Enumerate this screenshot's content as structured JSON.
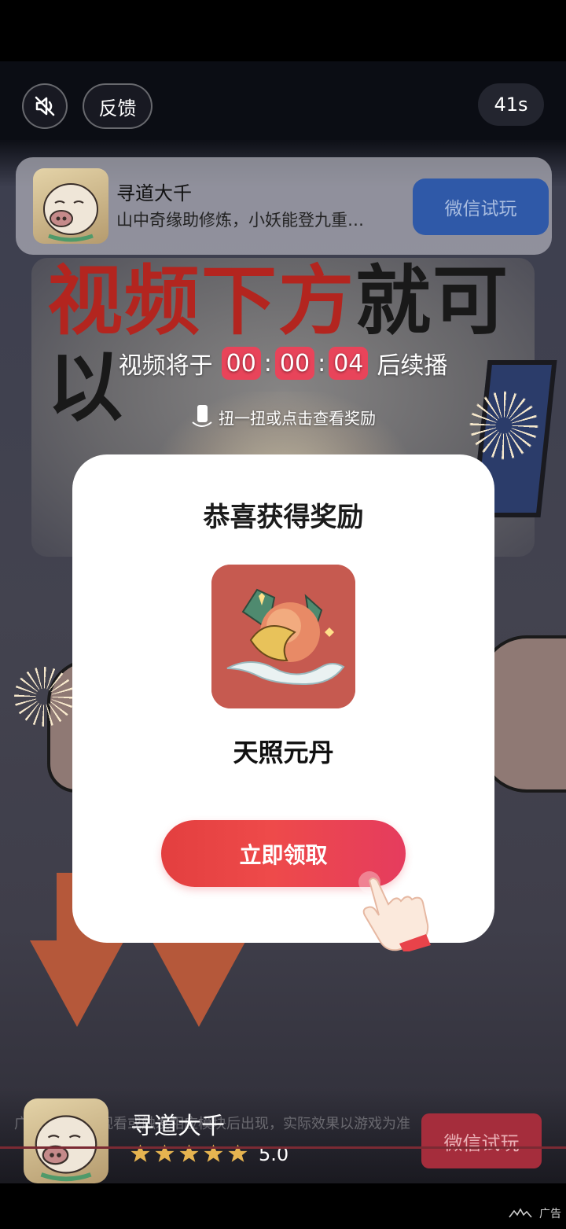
{
  "top_controls": {
    "feedback_label": "反馈",
    "timer": "41s"
  },
  "ad_card": {
    "title": "寻道大千",
    "subtitle": "山中奇缘助修炼，小妖能登九重…",
    "cta_label": "微信试玩",
    "cta_color": "#2f59a8"
  },
  "video": {
    "banner_red": "视频下方",
    "banner_dark_1": "就可",
    "banner_dark_2": "以"
  },
  "countdown": {
    "prefix": "视频将于",
    "hours": "00",
    "minutes": "00",
    "seconds": "04",
    "suffix": "后续播",
    "sep": ":"
  },
  "shake_hint": "扭一扭或点击查看奖励",
  "modal": {
    "heading": "恭喜获得奖励",
    "reward_icon": "golden-elixir-icon",
    "reward_name": "天照元丹",
    "claim_label": "立即领取",
    "claim_color": "#e8434a"
  },
  "bottom_bar": {
    "app_name": "寻道大千",
    "disclaimer": "广告内容需要观看或触发相应模块后出现，实际效果以游戏为准",
    "stars": 5,
    "rating": "5.0",
    "cta_label": "微信试玩",
    "cta_color": "#a52d3c"
  },
  "ad_tag": "广告"
}
